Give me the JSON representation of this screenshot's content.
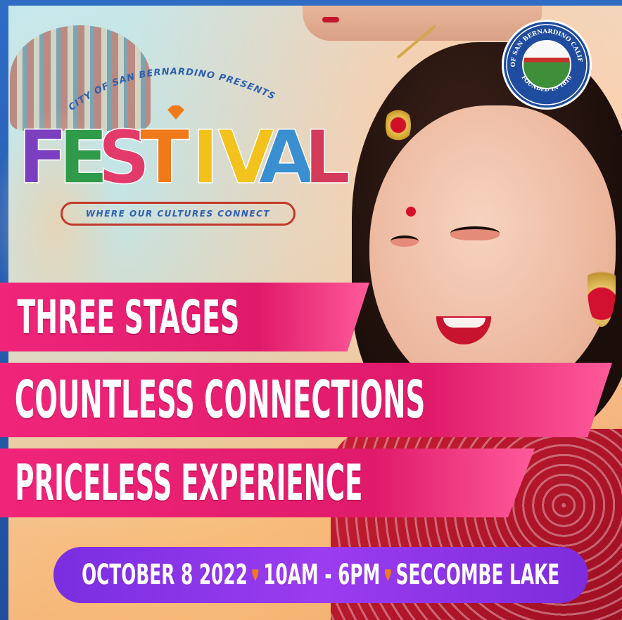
{
  "presenter": "CITY OF SAN BERNARDINO PRESENTS",
  "logo": {
    "title": "FESTIVAL",
    "letters": [
      "F",
      "E",
      "S",
      "T",
      "I",
      "V",
      "A",
      "L"
    ],
    "letter_colors": [
      "#7b3fc0",
      "#2f9a4a",
      "#e23a6a",
      "#f07a1a",
      "#f2c21a",
      "#f4c21c",
      "#3a8fd0",
      "#d43b5a"
    ],
    "tagline": "WHERE OUR CULTURES CONNECT"
  },
  "seal": {
    "outer_text": "CITY OF SAN BERNARDINO CALIFORNIA",
    "inner_text": "FOUNDED IN 1810"
  },
  "banners": [
    "THREE STAGES",
    "COUNTLESS CONNECTIONS",
    "PRICELESS EXPERIENCE"
  ],
  "event": {
    "date": "OCTOBER 8 2022",
    "time": "10AM - 6PM",
    "location": "SECCOMBE LAKE"
  },
  "colors": {
    "banner_pink": "#e8206f",
    "pill_purple": "#8a34e6",
    "accent_orange": "#f07a1a",
    "seal_blue": "#1f4c9e"
  }
}
